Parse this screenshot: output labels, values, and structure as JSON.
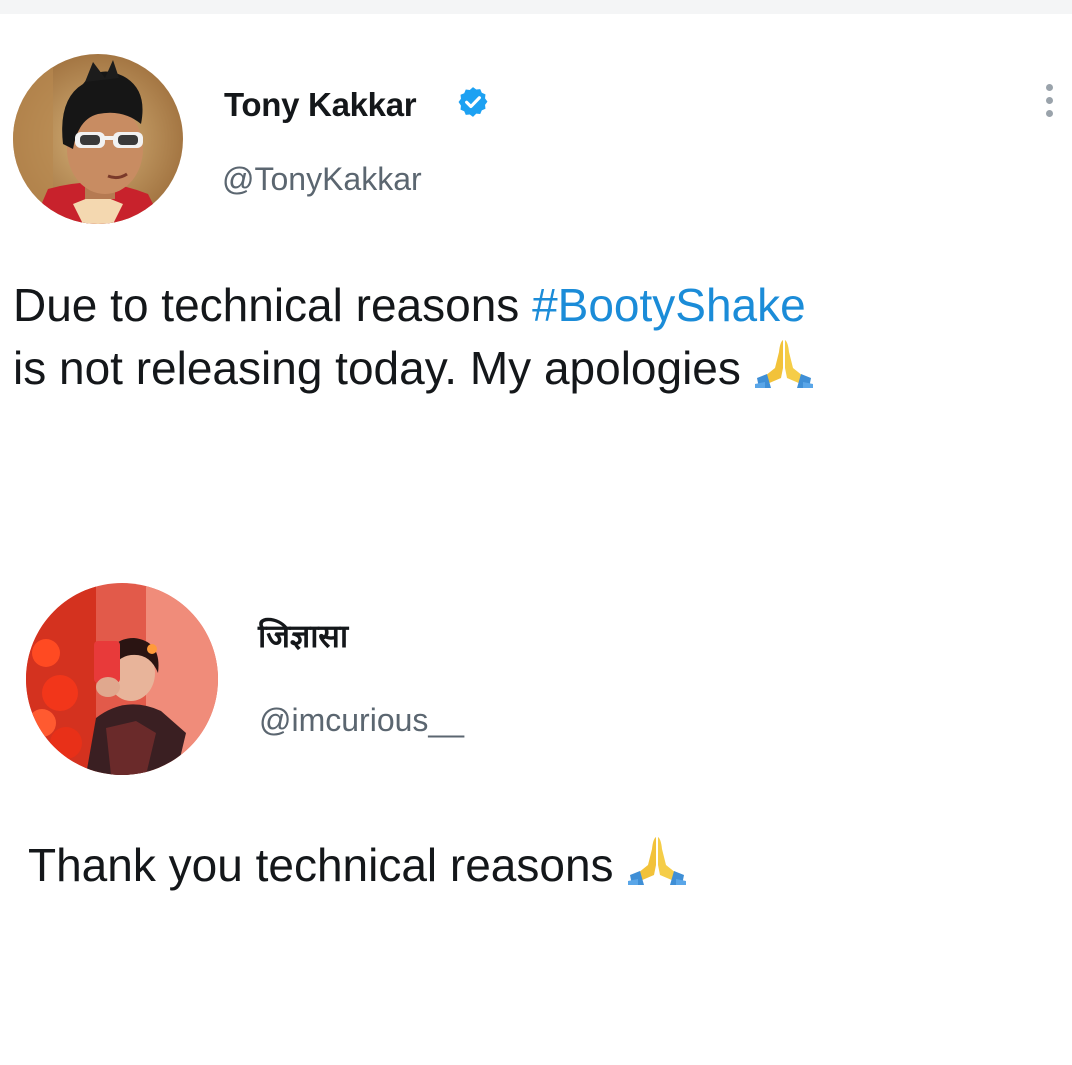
{
  "tweets": [
    {
      "display_name": "Tony Kakkar",
      "handle": "@TonyKakkar",
      "verified": true,
      "avatar_icon": "profile-photo-man-sunglasses",
      "body_line1": "Due to technical reasons",
      "hashtag": "#BootyShake",
      "body_line2": "is not releasing today. My apologies",
      "emoji": "folded-hands-icon"
    },
    {
      "display_name": "जिज्ञासा",
      "handle": "@imcurious__",
      "verified": false,
      "avatar_icon": "profile-photo-woman-red-background",
      "body_line1": "Thank you technical reasons",
      "emoji": "folded-hands-icon"
    }
  ],
  "colors": {
    "text": "#14171a",
    "handle": "#5b6670",
    "hashtag": "#1b8cd8",
    "verified_badge": "#1da1f2"
  }
}
